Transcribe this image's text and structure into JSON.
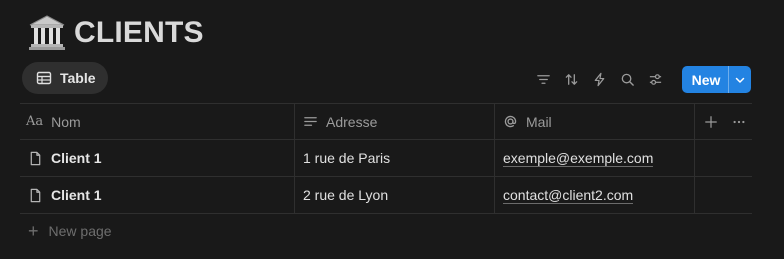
{
  "database": {
    "title": "CLIENTS",
    "icon": "classical-building-icon"
  },
  "view_tab": {
    "label": "Table",
    "icon": "table-icon"
  },
  "toolbar": {
    "icons": [
      "filter-icon",
      "sort-icon",
      "automation-bolt-icon",
      "search-icon",
      "settings-sliders-icon"
    ],
    "new_label": "New",
    "accent": "#2383e2"
  },
  "table": {
    "columns": [
      {
        "label": "Nom",
        "icon": "title-aa-icon"
      },
      {
        "label": "Adresse",
        "icon": "text-lines-icon"
      },
      {
        "label": "Mail",
        "icon": "at-icon"
      }
    ],
    "rows": [
      {
        "nom": "Client 1",
        "adresse": "1 rue de Paris",
        "mail": "exemple@exemple.com"
      },
      {
        "nom": "Client 1",
        "adresse": "2 rue de Lyon",
        "mail": "contact@client2.com"
      }
    ],
    "new_page_label": "New page"
  }
}
